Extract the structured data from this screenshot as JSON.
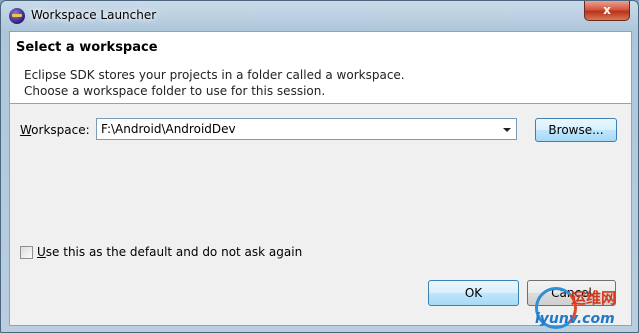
{
  "window": {
    "title": "Workspace Launcher",
    "close_label": "x"
  },
  "header": {
    "title": "Select a workspace",
    "description_line1": "Eclipse SDK stores your projects in a folder called a workspace.",
    "description_line2": "Choose a workspace folder to use for this session."
  },
  "workspace": {
    "label_mnemonic": "W",
    "label_rest": "orkspace:",
    "value": "F:\\Android\\AndroidDev",
    "browse_label": "Browse..."
  },
  "default_checkbox": {
    "mnemonic": "U",
    "label_rest": "se this as the default and do not ask again",
    "checked": false
  },
  "buttons": {
    "ok": "OK",
    "cancel": "Cancel"
  },
  "watermark": {
    "name": "运维网",
    "url": "iyunv.com"
  },
  "colors": {
    "close_button": "#c8432b",
    "focus_blue": "#3c7fb1"
  }
}
